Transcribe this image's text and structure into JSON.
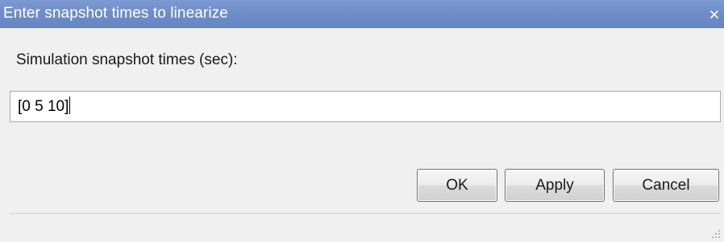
{
  "window": {
    "title": "Enter snapshot times to linearize",
    "close_icon": "close-icon"
  },
  "form": {
    "prompt_label": "Simulation snapshot times (sec):",
    "times_value": "[0 5 10]"
  },
  "buttons": {
    "ok_label": "OK",
    "apply_label": "Apply",
    "cancel_label": "Cancel"
  },
  "colors": {
    "titlebar": "#6f8ec9",
    "background": "#f0f0f0"
  }
}
